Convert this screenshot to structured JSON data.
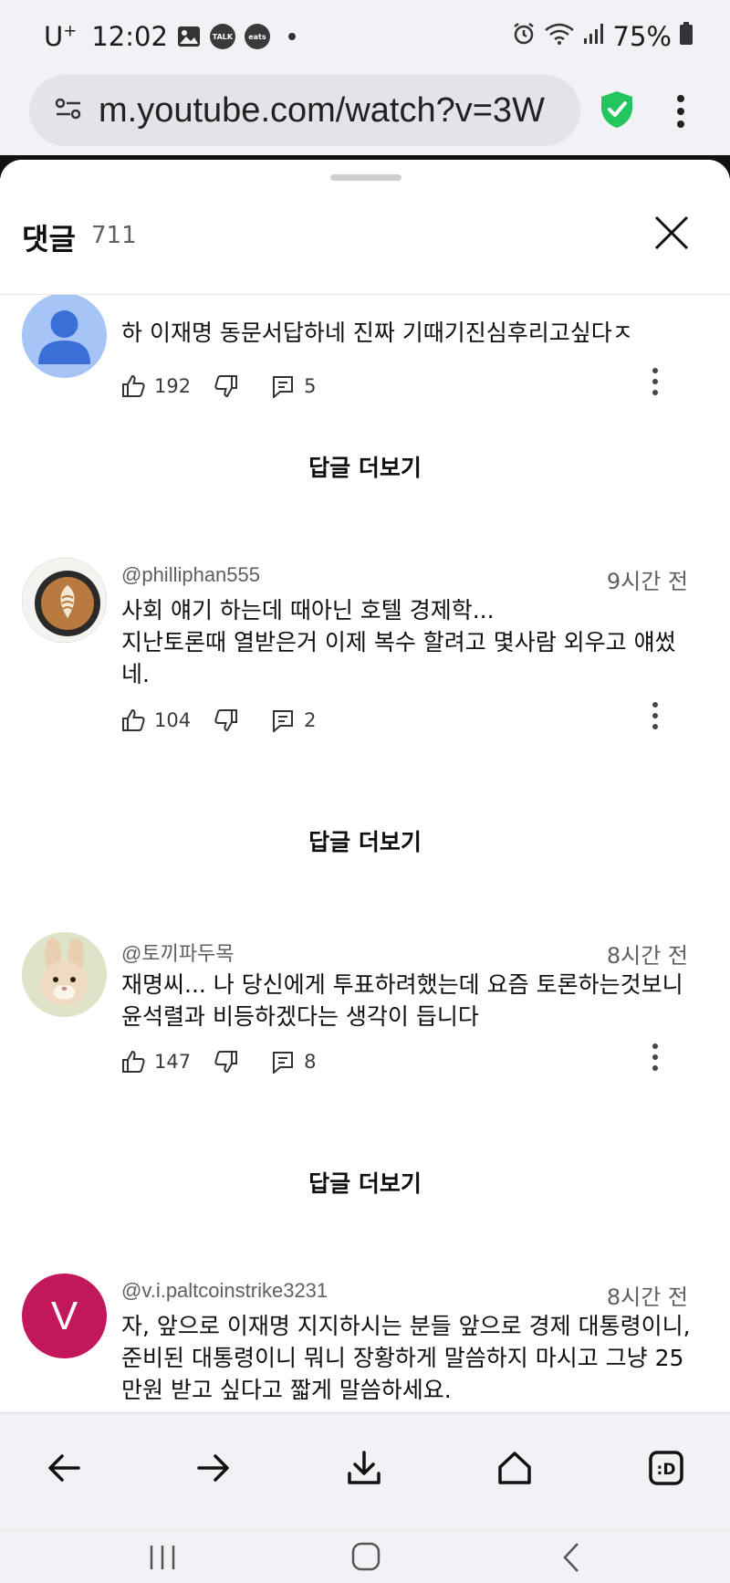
{
  "status_bar": {
    "carrier": "U",
    "carrier_sup": "+",
    "time": "12:02",
    "talk_badge": "TALK",
    "eats_badge": "eats",
    "battery": "75%"
  },
  "browser": {
    "url": "m.youtube.com/watch?v=3W"
  },
  "comments_panel": {
    "title": "댓글",
    "count": "711",
    "comments": [
      {
        "author": "",
        "time": "",
        "text": "하 이재명 동문서답하네 진짜 기때기진심후리고싶다ㅈ",
        "likes": "192",
        "replies": "5",
        "avatar": "default-person-avatar",
        "avatar_color": "#a6c4f5"
      },
      {
        "author": "@philliphan555",
        "time": "9시간 전",
        "text_lines": [
          "사회 얘기 하는데  때아닌 호텔 경제학...",
          "지난토론때 열받은거 이제 복수 할려고 몇사람 외우고  얘썼",
          "네."
        ],
        "likes": "104",
        "replies": "2",
        "avatar": "latte-art-avatar"
      },
      {
        "author": "@토끼파두목",
        "time": "8시간 전",
        "text_lines": [
          "재명씨... 나 당신에게 투표하려했는데 요즘 토론하는것보니",
          "윤석렬과 비등하겠다는 생각이 듭니다"
        ],
        "likes": "147",
        "replies": "8",
        "avatar": "bunny-avatar"
      },
      {
        "author": "@v.i.paltcoinstrike3231",
        "time": "8시간 전",
        "text_lines": [
          "자, 앞으로 이재명 지지하시는 분들 앞으로 경제 대통령이니,",
          "준비된 대통령이니 뭐니 장황하게 말씀하지 마시고 그냥 25",
          "만원 받고 싶다고 짧게 말씀하세요."
        ],
        "avatar_letter": "V",
        "avatar_color": "#c2185b"
      }
    ],
    "show_replies_label": "답글 더보기"
  },
  "colors": {
    "shield": "#22c55e",
    "accent_text": "#0f0f0f",
    "meta_text": "#606060"
  }
}
